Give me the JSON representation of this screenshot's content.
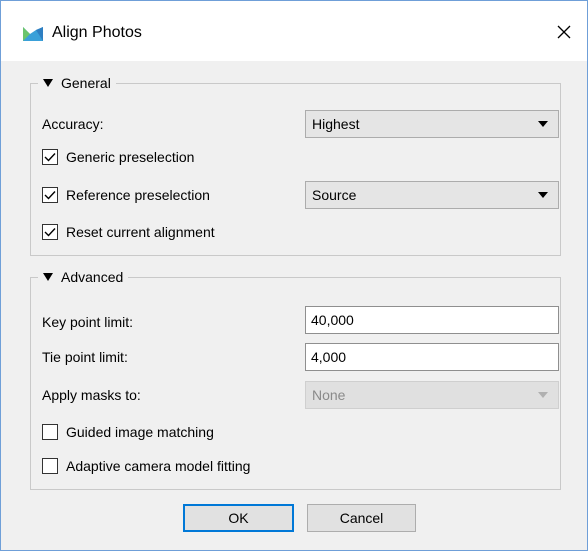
{
  "window": {
    "title": "Align Photos",
    "accent": "#0078d7"
  },
  "general": {
    "heading": "General",
    "accuracy_label": "Accuracy:",
    "accuracy_value": "Highest",
    "generic_preselection": {
      "label": "Generic preselection",
      "checked": true
    },
    "reference_preselection": {
      "label": "Reference preselection",
      "checked": true,
      "value": "Source"
    },
    "reset_alignment": {
      "label": "Reset current alignment",
      "checked": true
    }
  },
  "advanced": {
    "heading": "Advanced",
    "key_point_label": "Key point limit:",
    "key_point_value": "40,000",
    "tie_point_label": "Tie point limit:",
    "tie_point_value": "4,000",
    "masks_label": "Apply masks to:",
    "masks_value": "None",
    "guided_matching": {
      "label": "Guided image matching",
      "checked": false
    },
    "adaptive_fitting": {
      "label": "Adaptive camera model fitting",
      "checked": false
    }
  },
  "buttons": {
    "ok": "OK",
    "cancel": "Cancel"
  }
}
